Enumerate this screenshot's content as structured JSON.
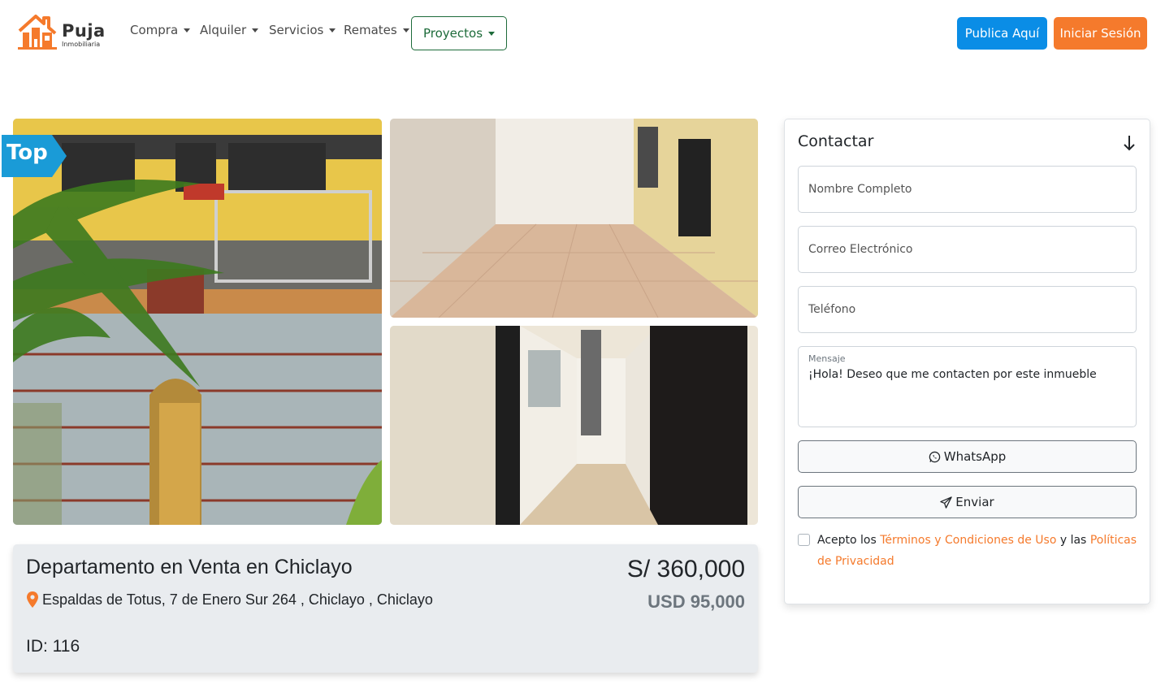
{
  "brand": {
    "name": "Puja",
    "subtitle": "Inmobiliaria",
    "accent": "#f57a2c"
  },
  "nav": {
    "items": [
      {
        "label": "Compra"
      },
      {
        "label": "Alquiler"
      },
      {
        "label": "Servicios"
      },
      {
        "label": "Remates"
      }
    ],
    "proyectos": "Proyectos",
    "publish_label": "Publica Aquí",
    "login_label": "Iniciar Sesión"
  },
  "gallery": {
    "badge": "Top"
  },
  "listing": {
    "title": "Departamento en Venta en Chiclayo",
    "address": "Espaldas de Totus, 7 de Enero Sur 264 , Chiclayo , Chiclayo",
    "id_label": "ID: 116",
    "price_pen": "S/ 360,000",
    "price_usd": "USD 95,000"
  },
  "contact": {
    "title": "Contactar",
    "name_placeholder": "Nombre Completo",
    "email_placeholder": "Correo Electrónico",
    "phone_placeholder": "Teléfono",
    "message_label": "Mensaje",
    "message_value": "¡Hola! Deseo que me contacten por este inmueble",
    "whatsapp_label": "WhatsApp",
    "send_label": "Enviar",
    "terms_prefix": "Acepto los ",
    "terms_link": "Términos y Condiciones de Uso",
    "terms_middle": " y las ",
    "privacy_link_1": "Políticas",
    "privacy_link_2": "de Privacidad"
  }
}
